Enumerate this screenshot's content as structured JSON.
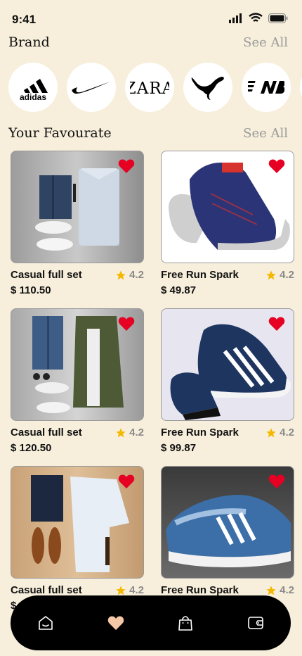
{
  "status": {
    "time": "9:41"
  },
  "brand_section": {
    "title": "Brand",
    "see_all": "See All"
  },
  "brands": [
    {
      "name": "adidas",
      "icon": "adidas-logo"
    },
    {
      "name": "Nike",
      "icon": "nike-swoosh-logo"
    },
    {
      "name": "ZARA",
      "icon": "zara-logo"
    },
    {
      "name": "Puma",
      "icon": "puma-logo"
    },
    {
      "name": "New Balance",
      "icon": "new-balance-logo"
    }
  ],
  "favourite_section": {
    "title": "Your Favourate",
    "see_all": "See All"
  },
  "products": [
    {
      "name": "Casual full set",
      "price": "$ 110.50",
      "rating": "4.2"
    },
    {
      "name": "Free Run Spark",
      "price": "$ 49.87",
      "rating": "4.2"
    },
    {
      "name": "Casual full set",
      "price": "$ 120.50",
      "rating": "4.2"
    },
    {
      "name": "Free Run Spark",
      "price": "$ 99.87",
      "rating": "4.2"
    },
    {
      "name": "Casual full set",
      "price": "$",
      "rating": "4.2"
    },
    {
      "name": "Free Run Spark",
      "price": "",
      "rating": "4.2"
    }
  ],
  "nav": [
    {
      "icon": "home-icon"
    },
    {
      "icon": "heart-icon"
    },
    {
      "icon": "bag-icon"
    },
    {
      "icon": "wallet-icon"
    }
  ],
  "colors": {
    "background": "#f7efdc",
    "accent": "#e60023",
    "nav_active": "#f4c7a6"
  }
}
